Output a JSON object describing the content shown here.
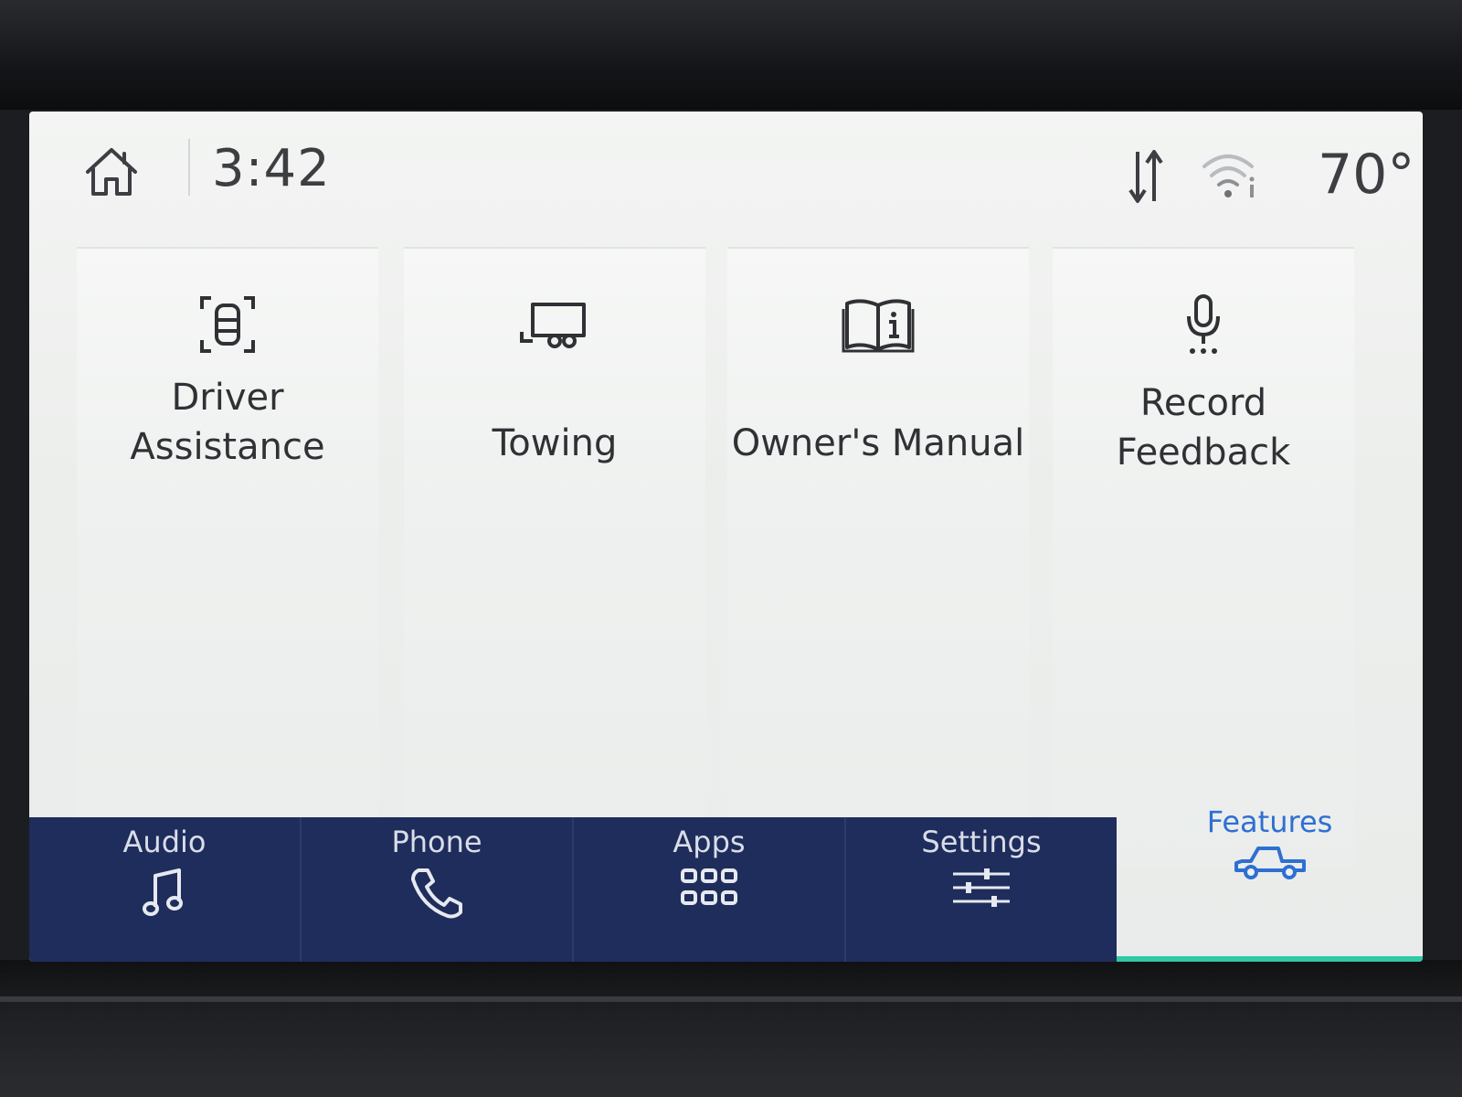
{
  "status": {
    "time": "3:42",
    "temperature": "70°",
    "icons": [
      "home-icon",
      "sync-arrows-icon",
      "wifi-hotspot-icon"
    ]
  },
  "features": [
    {
      "label_line1": "Driver",
      "label_line2": "Assistance",
      "icon": "driver-assist-icon"
    },
    {
      "label_line1": "Towing",
      "label_line2": "",
      "icon": "trailer-icon"
    },
    {
      "label_line1": "Owner's Manual",
      "label_line2": "",
      "icon": "book-info-icon"
    },
    {
      "label_line1": "Record",
      "label_line2": "Feedback",
      "icon": "microphone-icon"
    }
  ],
  "nav": {
    "audio": "Audio",
    "phone": "Phone",
    "apps": "Apps",
    "settings": "Settings",
    "features": "Features",
    "active": "features"
  },
  "colors": {
    "nav_background": "#1f2d5c",
    "active_accent": "#2f6fd2",
    "active_indicator": "#33c8a4"
  }
}
